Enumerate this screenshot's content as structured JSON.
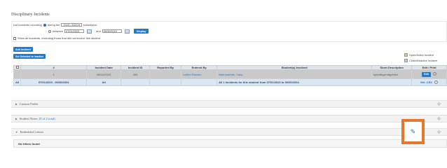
{
  "page": {
    "title": "Disciplinary Incidents"
  },
  "filter": {
    "prefix": "List incidents occurring",
    "during_label": "during the",
    "school_year": "2023 - 2024",
    "school_year_suffix": "schoolyear",
    "between_label": "between",
    "start_date": "07/01/2023",
    "and_label": "and",
    "end_date": "06/30/2024",
    "display_button": "Display",
    "show_all_label": "Show all incidents, excluding those that did not involve this student"
  },
  "actions": {
    "add_incident": "Add Incident",
    "set_selected_inactive": "Set Selected to Inactive"
  },
  "legend": {
    "open_active": "Open/Active Incident",
    "closed_inactive": "Closed/Inactive Incident",
    "open_color": "#a9e08f",
    "closed_color": "#c9c9c9"
  },
  "table": {
    "headers": {
      "num": "#",
      "incident_date": "Incident Date",
      "incident_id": "Incident ID",
      "reported_by": "Reported By",
      "entered_by": "Entered By",
      "students": "Student(s) Involved",
      "short_desc": "Short Description",
      "edit_print": "Edit / Print"
    },
    "row": {
      "num": "1",
      "incident_date": "08/24/2023",
      "incident_id": "283",
      "reported_by": "",
      "entered_by": "LeAnn Reeves",
      "students": "Abercrombie, Carly",
      "short_desc": "fghcdfhgxhdfgcfdsd",
      "edit_label": "Edit"
    },
    "summary": {
      "all_label": "All",
      "date_range": "07/01/2023 - 06/30/2024",
      "all_dates": "All",
      "message": "All 1 incidents for this student from 07/01/2023 to 06/30/2024.",
      "export": "Get .CSV"
    }
  },
  "sections": {
    "custom_fields": "Custom Fields",
    "student_notes": "Student Notes",
    "student_notes_count": "(0 of 2 total)",
    "embedded_letters": "Embedded Letters",
    "no_letters": "No letters found"
  },
  "icons": {
    "calendar": "calendar-icon",
    "gear": "gear-icon",
    "move": "move-icon",
    "pencil": "pencil-icon"
  },
  "colors": {
    "accent": "#1f7ad1",
    "highlight": "#e8772e"
  }
}
